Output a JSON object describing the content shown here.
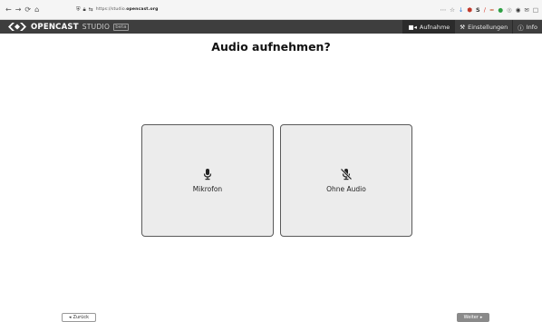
{
  "browser": {
    "url_prefix": "https://studio.",
    "url_domain": "opencast.org",
    "nav": {
      "back": "←",
      "forward": "→",
      "reload": "⟳",
      "home": "⌂"
    }
  },
  "header": {
    "brand": "OPENCAST",
    "studio": "STUDIO",
    "beta": "beta",
    "nav": [
      {
        "label": "Aufnahme",
        "icon": "video-icon",
        "active": true
      },
      {
        "label": "Einstellungen",
        "icon": "wrench-icon",
        "active": false
      },
      {
        "label": "Info",
        "icon": "info-icon",
        "active": false
      }
    ]
  },
  "main": {
    "title": "Audio aufnehmen?",
    "options": [
      {
        "label": "Mikrofon",
        "icon": "microphone-icon"
      },
      {
        "label": "Ohne Audio",
        "icon": "microphone-slash-icon"
      }
    ]
  },
  "footer": {
    "back_label": "Zurück",
    "next_label": "Weiter"
  },
  "colors": {
    "header_bg": "#3e3e3e",
    "option_bg": "#ececec",
    "next_bg": "#8a8a8a"
  }
}
